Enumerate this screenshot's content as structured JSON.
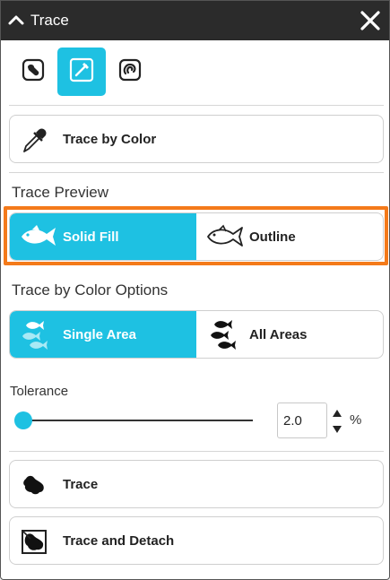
{
  "panel": {
    "title": "Trace",
    "collapse_icon": "chevron-up-icon",
    "close_icon": "close-icon"
  },
  "mode_buttons": [
    {
      "name": "shape-trace-icon",
      "active": false
    },
    {
      "name": "color-picker-icon",
      "active": true
    },
    {
      "name": "magnet-trace-icon",
      "active": false
    }
  ],
  "trace_by_color": {
    "label": "Trace by Color",
    "icon": "eyedropper-icon"
  },
  "trace_preview": {
    "heading": "Trace Preview",
    "options": [
      {
        "label": "Solid Fill",
        "icon": "fish-solid-icon",
        "selected": true
      },
      {
        "label": "Outline",
        "icon": "fish-outline-icon",
        "selected": false
      }
    ]
  },
  "color_options": {
    "heading": "Trace by Color Options",
    "options": [
      {
        "label": "Single Area",
        "icon": "fish-single-icon",
        "selected": true
      },
      {
        "label": "All Areas",
        "icon": "fish-school-icon",
        "selected": false
      }
    ]
  },
  "tolerance": {
    "label": "Tolerance",
    "value": "2.0",
    "unit": "%",
    "slider_fraction": 0.02
  },
  "actions": {
    "trace_label": "Trace",
    "trace_icon": "trace-shape-icon",
    "trace_detach_label": "Trace and Detach",
    "trace_detach_icon": "trace-detach-icon"
  },
  "colors": {
    "accent": "#1ec1e2",
    "titlebar": "#2b2b2b",
    "highlight": "#f47a1a"
  }
}
